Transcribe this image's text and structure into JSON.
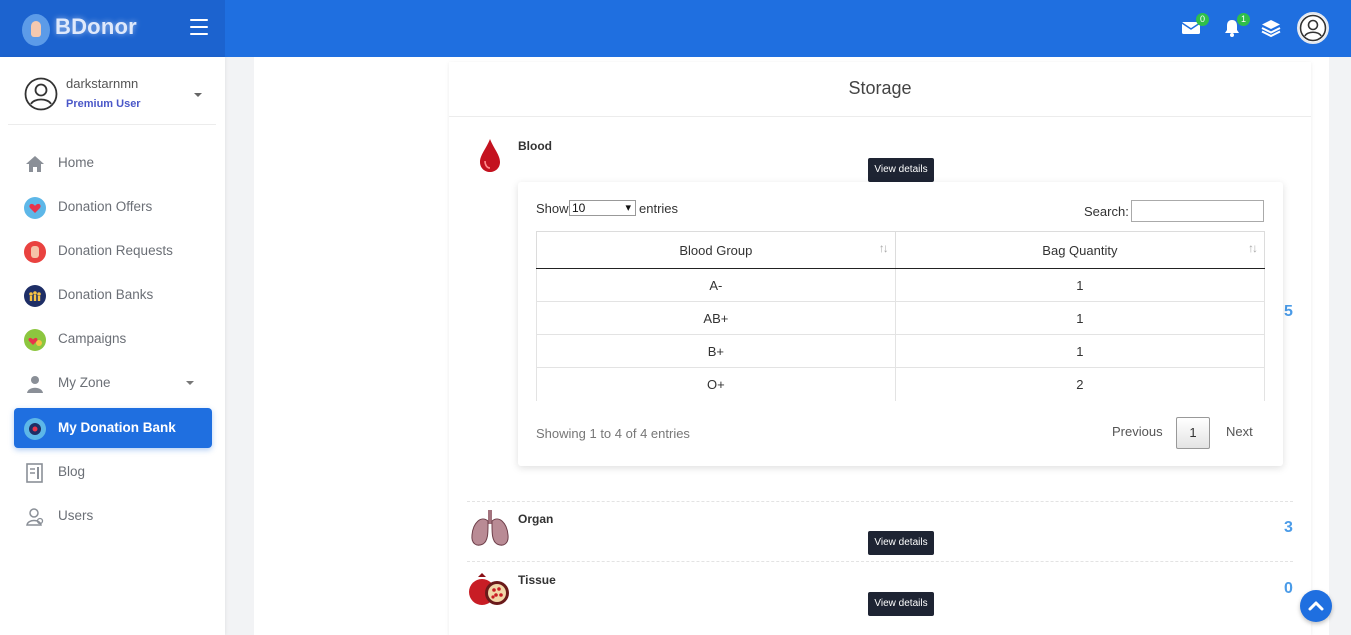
{
  "brand": {
    "name": "BDonor"
  },
  "header": {
    "mail_count": "0",
    "notification_count": "1"
  },
  "user": {
    "name": "darkstarnmn",
    "role": "Premium User"
  },
  "sidebar": {
    "items": [
      {
        "label": "Home",
        "icon": "home-icon"
      },
      {
        "label": "Donation Offers",
        "icon": "heart-hand-icon"
      },
      {
        "label": "Donation Requests",
        "icon": "hand-request-icon"
      },
      {
        "label": "Donation Banks",
        "icon": "people-bank-icon"
      },
      {
        "label": "Campaigns",
        "icon": "campaign-icon"
      },
      {
        "label": "My Zone",
        "icon": "person-icon"
      },
      {
        "label": "My Donation Bank",
        "icon": "bank-badge-icon",
        "active": true
      },
      {
        "label": "Blog",
        "icon": "blog-icon"
      },
      {
        "label": "Users",
        "icon": "users-icon"
      }
    ]
  },
  "storage": {
    "title": "Storage",
    "items": [
      {
        "label": "Blood",
        "count": "5",
        "button": "View details"
      },
      {
        "label": "Organ",
        "count": "3",
        "button": "View details"
      },
      {
        "label": "Tissue",
        "count": "0",
        "button": "View details"
      }
    ]
  },
  "table": {
    "show_label": "Show",
    "page_size": "10",
    "entries_label": "entries",
    "search_label": "Search:",
    "search_value": "",
    "columns": [
      "Blood Group",
      "Bag Quantity"
    ],
    "rows": [
      [
        "A-",
        "1"
      ],
      [
        "AB+",
        "1"
      ],
      [
        "B+",
        "1"
      ],
      [
        "O+",
        "2"
      ]
    ],
    "info": "Showing 1 to 4 of 4 entries",
    "pagination": {
      "previous": "Previous",
      "page": "1",
      "next": "Next"
    }
  },
  "colors": {
    "primary": "#1f6fe0",
    "dark_button": "#1e2433",
    "count": "#4a9be8",
    "role": "#4a57c8"
  }
}
